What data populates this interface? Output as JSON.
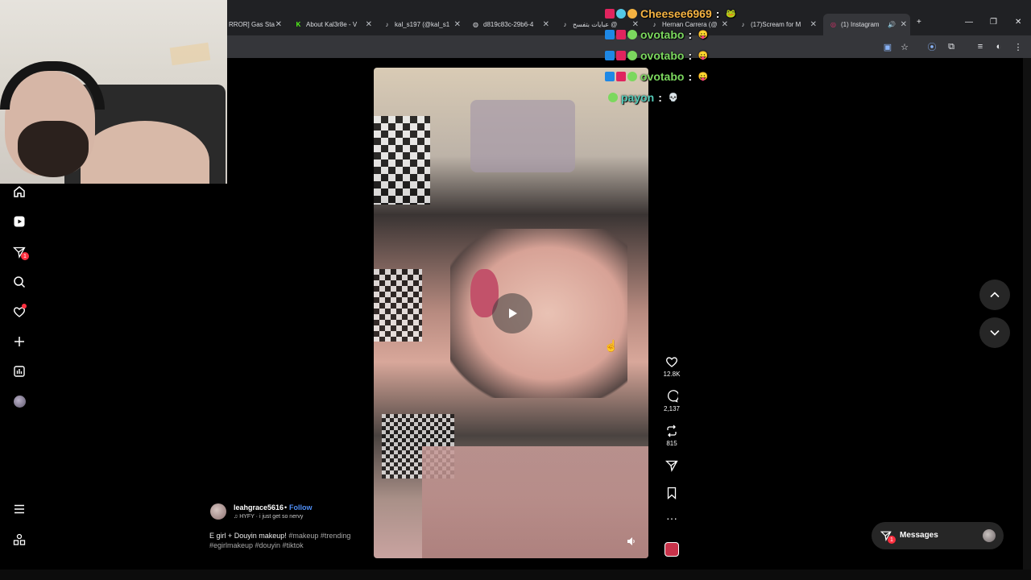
{
  "browser": {
    "tabs": [
      {
        "label": "RROR] Gas Sta",
        "icon": "doc-icon"
      },
      {
        "label": "About Kal3r8e - V",
        "icon": "kick-icon"
      },
      {
        "label": "kal_s197 (@kal_s1",
        "icon": "tiktok-icon"
      },
      {
        "label": "d819c83c-29b6-4",
        "icon": "globe-icon"
      },
      {
        "label": "عبايات بتفسح @",
        "icon": "tiktok-icon"
      },
      {
        "label": "Hernan Carrera (@",
        "icon": "tiktok-icon"
      },
      {
        "label": "(17)Scream for M",
        "icon": "tiktok-icon"
      },
      {
        "label": "(1) Instagram",
        "icon": "instagram-icon",
        "active": true
      }
    ],
    "new_tab": "+",
    "window_controls": {
      "minimize": "—",
      "maximize": "❐",
      "close": "✕"
    }
  },
  "sidebar": {
    "items": [
      {
        "name": "home",
        "icon": "home-icon"
      },
      {
        "name": "reels",
        "icon": "reels-icon"
      },
      {
        "name": "direct",
        "icon": "direct-icon",
        "badge": "1"
      },
      {
        "name": "search",
        "icon": "search-icon"
      },
      {
        "name": "notifications",
        "icon": "heart-icon"
      },
      {
        "name": "create",
        "icon": "plus-icon"
      },
      {
        "name": "dashboard",
        "icon": "dashboard-icon"
      },
      {
        "name": "profile",
        "icon": "avatar-icon"
      }
    ],
    "bottom": [
      {
        "name": "more",
        "icon": "menu-icon"
      },
      {
        "name": "also-from-meta",
        "icon": "threads-icon"
      }
    ]
  },
  "reel": {
    "actions": {
      "likes": "12.8K",
      "comments": "2,137",
      "reposts": "815"
    },
    "author": {
      "username": "leahgrace5616",
      "separator": "•",
      "follow_label": "Follow"
    },
    "audio": "♫ HYFY · i just get so nervy",
    "caption_text": "E girl + Douyin makeup!",
    "caption_tags": "#makeup #trending #egirlmakeup #douyin #tiktok"
  },
  "messages": {
    "label": "Messages",
    "badge": "1"
  },
  "chat": [
    {
      "user": "Cheesee6969",
      "color": "#f5b342",
      "emote": "🐸"
    },
    {
      "user": "ovotabo",
      "color": "#7bd85e",
      "emote": "😛"
    },
    {
      "user": "ovotabo",
      "color": "#7bd85e",
      "emote": "😛"
    },
    {
      "user": "ovotabo",
      "color": "#7bd85e",
      "emote": "😛"
    },
    {
      "user": "payon",
      "color": "#53c9b6",
      "emote": "💀"
    }
  ],
  "chat_separator": ":"
}
